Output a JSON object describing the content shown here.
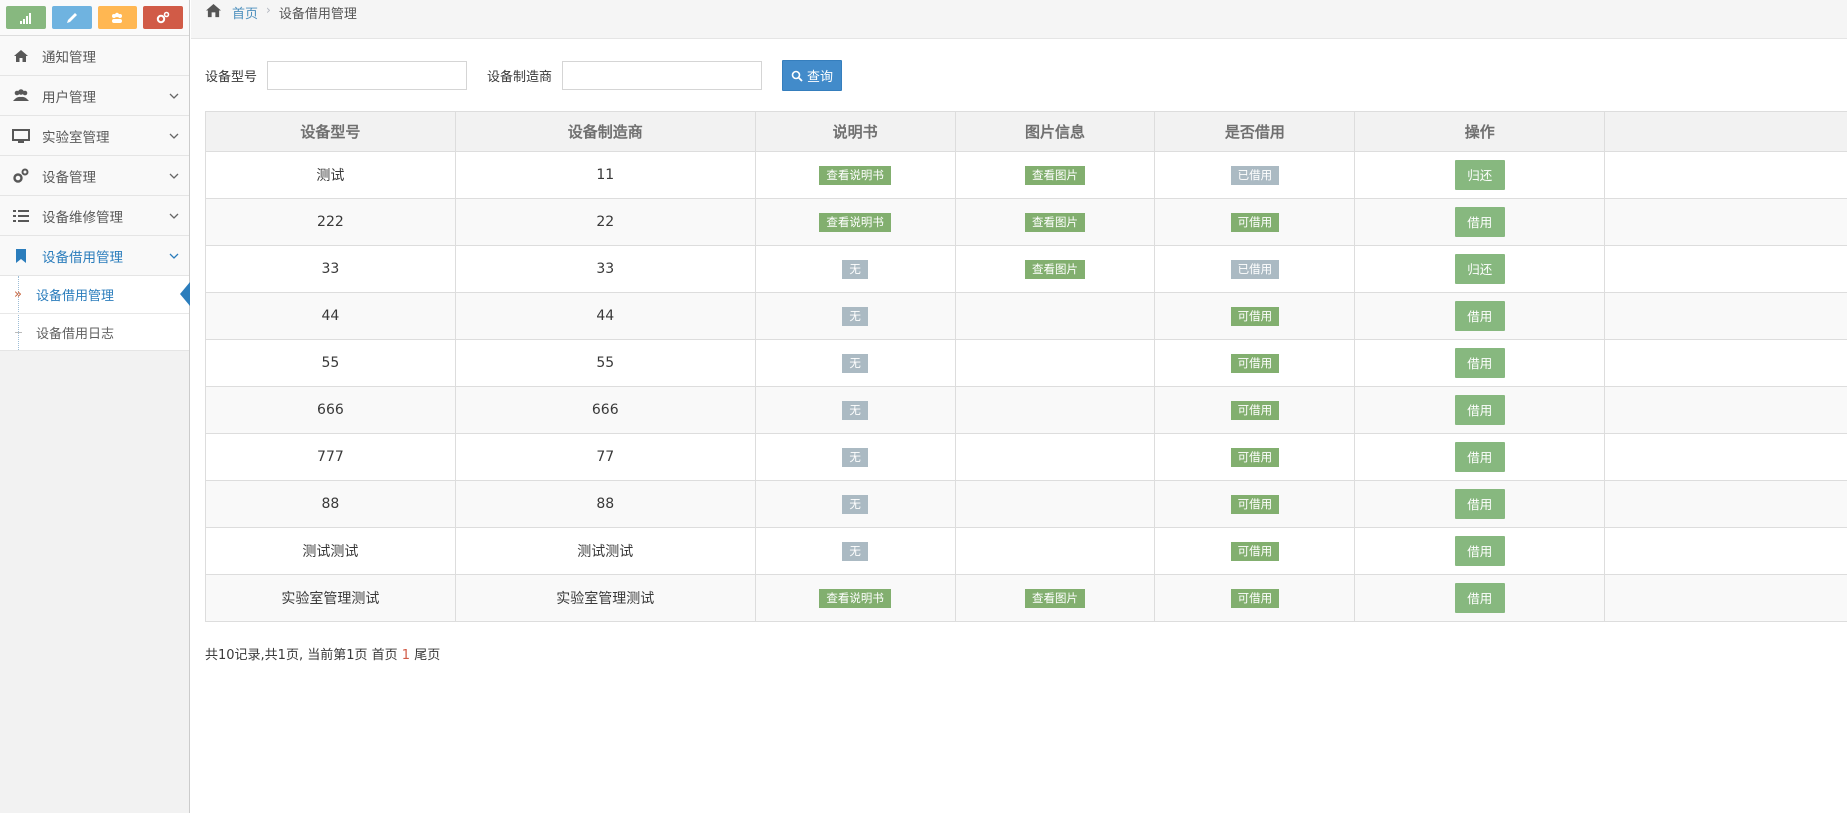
{
  "sidebar": {
    "shortcut_colors": [
      "#87b87f",
      "#6fb3e0",
      "#ffb752",
      "#d15b47"
    ],
    "shortcut_icons": [
      "signal-icon",
      "pencil-icon",
      "users-icon",
      "cogs-icon"
    ],
    "items": [
      {
        "label": "通知管理",
        "icon": "home-icon",
        "has_arrow": false
      },
      {
        "label": "用户管理",
        "icon": "users-icon",
        "has_arrow": true
      },
      {
        "label": "实验室管理",
        "icon": "desktop-icon",
        "has_arrow": true
      },
      {
        "label": "设备管理",
        "icon": "cogs-icon",
        "has_arrow": true
      },
      {
        "label": "设备维修管理",
        "icon": "list-icon",
        "has_arrow": true
      },
      {
        "label": "设备借用管理",
        "icon": "bookmark-icon",
        "has_arrow": true
      }
    ],
    "submenu": [
      {
        "label": "设备借用管理"
      },
      {
        "label": "设备借用日志"
      }
    ]
  },
  "breadcrumb": {
    "home": "首页",
    "current": "设备借用管理"
  },
  "search": {
    "model_label": "设备型号",
    "model_value": "",
    "maker_label": "设备制造商",
    "maker_value": "",
    "button_label": "查询"
  },
  "table": {
    "headers": [
      "设备型号",
      "设备制造商",
      "说明书",
      "图片信息",
      "是否借用",
      "操作",
      ""
    ],
    "rows": [
      {
        "model": "测试",
        "maker": "11",
        "manual": "查看说明书",
        "manual_type": "green",
        "image": "查看图片",
        "status": "已借用",
        "status_type": "gray",
        "action": "归还"
      },
      {
        "model": "222",
        "maker": "22",
        "manual": "查看说明书",
        "manual_type": "green",
        "image": "查看图片",
        "status": "可借用",
        "status_type": "green",
        "action": "借用"
      },
      {
        "model": "33",
        "maker": "33",
        "manual": "无",
        "manual_type": "gray",
        "image": "查看图片",
        "status": "已借用",
        "status_type": "gray",
        "action": "归还"
      },
      {
        "model": "44",
        "maker": "44",
        "manual": "无",
        "manual_type": "gray",
        "image": "",
        "status": "可借用",
        "status_type": "green",
        "action": "借用"
      },
      {
        "model": "55",
        "maker": "55",
        "manual": "无",
        "manual_type": "gray",
        "image": "",
        "status": "可借用",
        "status_type": "green",
        "action": "借用"
      },
      {
        "model": "666",
        "maker": "666",
        "manual": "无",
        "manual_type": "gray",
        "image": "",
        "status": "可借用",
        "status_type": "green",
        "action": "借用"
      },
      {
        "model": "777",
        "maker": "77",
        "manual": "无",
        "manual_type": "gray",
        "image": "",
        "status": "可借用",
        "status_type": "green",
        "action": "借用"
      },
      {
        "model": "88",
        "maker": "88",
        "manual": "无",
        "manual_type": "gray",
        "image": "",
        "status": "可借用",
        "status_type": "green",
        "action": "借用"
      },
      {
        "model": "测试测试",
        "maker": "测试测试",
        "manual": "无",
        "manual_type": "gray",
        "image": "",
        "status": "可借用",
        "status_type": "green",
        "action": "借用"
      },
      {
        "model": "实验室管理测试",
        "maker": "实验室管理测试",
        "manual": "查看说明书",
        "manual_type": "green",
        "image": "查看图片",
        "status": "可借用",
        "status_type": "green",
        "action": "借用"
      }
    ]
  },
  "pager": {
    "prefix": "共10记录,共1页, 当前第1页 首页",
    "current_page": "1",
    "last": "尾页"
  }
}
